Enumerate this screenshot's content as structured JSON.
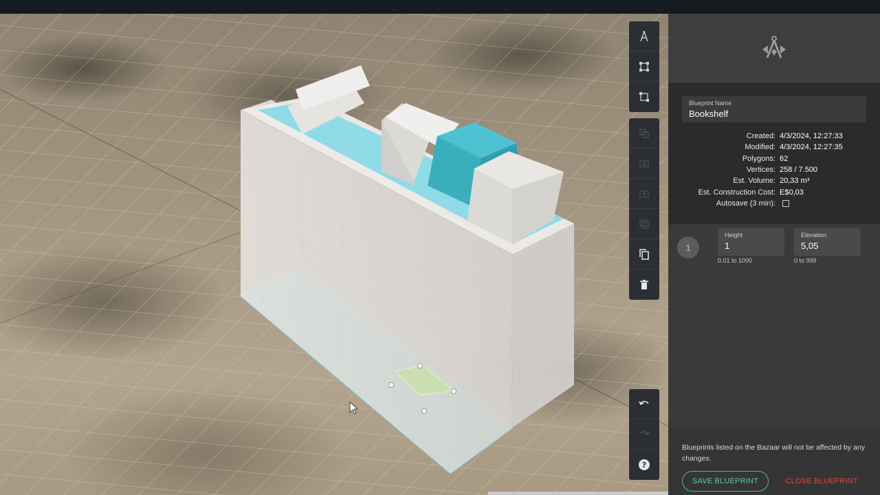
{
  "colors": {
    "accent": "#5fc9b3",
    "danger": "#e0463c",
    "cyan": "#4cc9de"
  },
  "toolbar_top": [
    {
      "icon": "draw-tool-icon",
      "enabled": true
    },
    {
      "icon": "vertex-edit-icon",
      "enabled": true
    },
    {
      "icon": "edge-edit-icon",
      "enabled": true
    }
  ],
  "toolbar_mid": [
    {
      "icon": "copy-shape-icon",
      "enabled": false
    },
    {
      "icon": "move-down-icon",
      "enabled": false
    },
    {
      "icon": "move-up-icon",
      "enabled": false
    },
    {
      "icon": "duplicate-icon",
      "enabled": false
    },
    {
      "icon": "copy-icon",
      "enabled": true
    },
    {
      "icon": "trash-icon",
      "enabled": true
    }
  ],
  "toolbar_bottom": [
    {
      "icon": "undo-icon",
      "enabled": true
    },
    {
      "icon": "redo-icon",
      "enabled": false
    },
    {
      "icon": "help-icon",
      "enabled": true
    }
  ],
  "panel": {
    "logo_icon": "compass-logo-icon",
    "blueprint_name_label": "Blueprint Name",
    "blueprint_name": "Bookshelf",
    "meta": {
      "created_label": "Created:",
      "created": "4/3/2024, 12:27:33",
      "modified_label": "Modified:",
      "modified": "4/3/2024, 12:27:35",
      "polygons_label": "Polygons:",
      "polygons": "62",
      "vertices_label": "Vertices:",
      "vertices": "258 / 7.500",
      "volume_label": "Est. Volume:",
      "volume": "20,33 m³",
      "cost_label": "Est. Construction Cost:",
      "cost": "E$0,03",
      "autosave_label": "Autosave (3 min):",
      "autosave_checked": false
    },
    "section": {
      "number": "1",
      "height_label": "Height",
      "height_value": "1",
      "height_hint": "0.01 to 1000",
      "elevation_label": "Elevation",
      "elevation_value": "5,05",
      "elevation_hint": "0 to 999"
    },
    "notice": "Blueprints listed on the Bazaar will not be affected by any changes.",
    "save_label": "SAVE BLUEPRINT",
    "close_label": "CLOSE BLUEPRINT"
  }
}
